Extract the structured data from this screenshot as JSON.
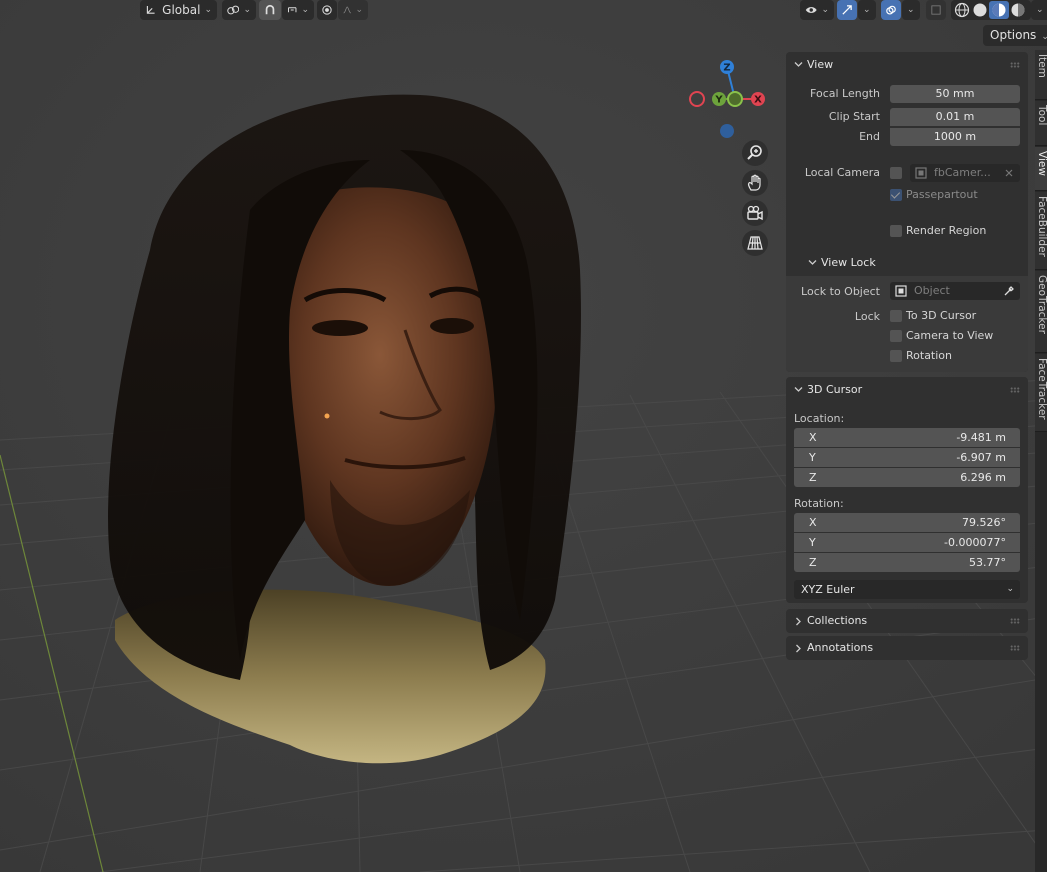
{
  "header": {
    "orientation_label": "Global",
    "options_label": "Options"
  },
  "gizmo": {
    "axis_z": "Z",
    "axis_y": "Y",
    "axis_x": "X"
  },
  "tabs": [
    "Item",
    "Tool",
    "View",
    "FaceBuilder",
    "GeoTracker",
    "FaceTracker"
  ],
  "view_panel": {
    "title": "View",
    "focal_length_label": "Focal Length",
    "focal_length_value": "50 mm",
    "clip_start_label": "Clip Start",
    "clip_start_value": "0.01 m",
    "end_label": "End",
    "end_value": "1000 m",
    "local_camera_label": "Local Camera",
    "local_camera_value": "fbCamer...",
    "passepartout_label": "Passepartout",
    "render_region_label": "Render Region"
  },
  "view_lock": {
    "title": "View Lock",
    "lock_to_object_label": "Lock to Object",
    "object_placeholder": "Object",
    "lock_label": "Lock",
    "to_3d_cursor_label": "To 3D Cursor",
    "camera_to_view_label": "Camera to View",
    "rotation_label": "Rotation"
  },
  "cursor_panel": {
    "title": "3D Cursor",
    "location_label": "Location:",
    "location": [
      {
        "axis": "X",
        "value": "-9.481 m"
      },
      {
        "axis": "Y",
        "value": "-6.907 m"
      },
      {
        "axis": "Z",
        "value": "6.296 m"
      }
    ],
    "rotation_label": "Rotation:",
    "rotation": [
      {
        "axis": "X",
        "value": "79.526°"
      },
      {
        "axis": "Y",
        "value": "-0.000077°"
      },
      {
        "axis": "Z",
        "value": "53.77°"
      }
    ],
    "rotation_mode": "XYZ Euler"
  },
  "collapsed_panels": {
    "collections": "Collections",
    "annotations": "Annotations"
  },
  "colors": {
    "accent": "#4772b3",
    "axis_x": "#e04451",
    "axis_y": "#6da33c",
    "axis_z": "#2f80d8",
    "background": "#3d3d3d",
    "panel": "#303030"
  },
  "icons": [
    "transform-orientation-icon",
    "pivot-icon",
    "snap-icon",
    "snap-target-icon",
    "proportional-edit-icon",
    "falloff-icon",
    "visibility-icon",
    "gizmo-icon",
    "overlay-icon",
    "xray-icon",
    "wireframe-shading-icon",
    "solid-shading-icon",
    "material-shading-icon",
    "rendered-shading-icon",
    "zoom-icon",
    "pan-hand-icon",
    "camera-view-icon",
    "perspective-grid-icon",
    "eyedropper-icon",
    "close-icon"
  ]
}
